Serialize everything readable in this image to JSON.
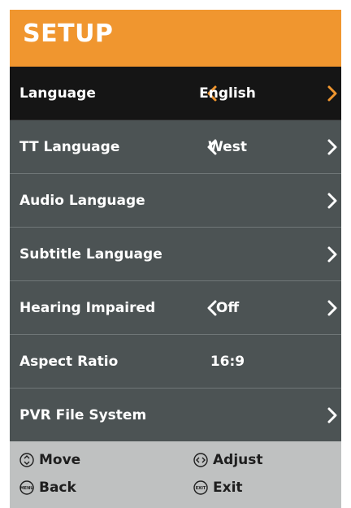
{
  "header": {
    "title": "SETUP"
  },
  "colors": {
    "accent": "#f0962f",
    "panel": "#4c5354",
    "selected": "#151515",
    "footer": "#bfc1c1"
  },
  "menu": {
    "items": [
      {
        "label": "Language",
        "value": "English",
        "arrows": "both",
        "selected": true
      },
      {
        "label": "TT Language",
        "value": "West",
        "arrows": "both",
        "selected": false
      },
      {
        "label": "Audio Language",
        "value": "",
        "arrows": "right",
        "selected": false
      },
      {
        "label": "Subtitle Language",
        "value": "",
        "arrows": "right",
        "selected": false
      },
      {
        "label": "Hearing Impaired",
        "value": "Off",
        "arrows": "both",
        "selected": false
      },
      {
        "label": "Aspect Ratio",
        "value": "16:9",
        "arrows": "none",
        "selected": false
      },
      {
        "label": "PVR File System",
        "value": "",
        "arrows": "right",
        "selected": false
      }
    ]
  },
  "footer": {
    "move": {
      "label": "Move",
      "icon": "up-down-circle-icon"
    },
    "adjust": {
      "label": "Adjust",
      "icon": "left-right-circle-icon"
    },
    "back": {
      "label": "Back",
      "icon": "menu-button-icon",
      "icon_text": "MENU"
    },
    "exit": {
      "label": "Exit",
      "icon": "exit-button-icon",
      "icon_text": "EXIT"
    }
  }
}
